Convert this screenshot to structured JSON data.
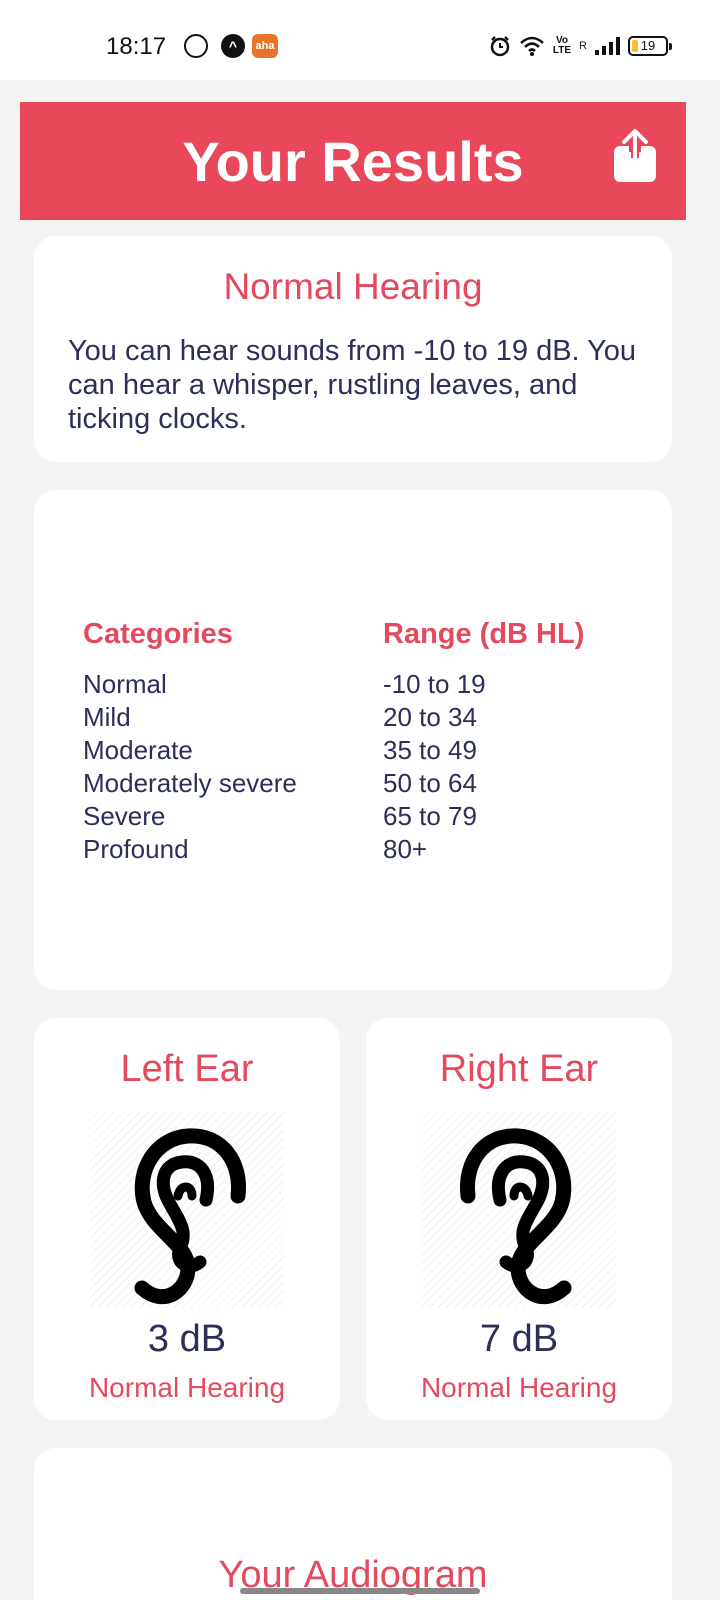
{
  "status_bar": {
    "time": "18:17",
    "battery": "19",
    "network_label": "Vo\nLTE",
    "roaming": "R",
    "apps": [
      "whatsapp-icon",
      "a-icon",
      "aha-icon"
    ],
    "aha_label": "aha"
  },
  "header": {
    "title": "Your Results",
    "background": "#e9475a",
    "share_icon": "share-icon"
  },
  "summary": {
    "title": "Normal Hearing",
    "description": "You can hear sounds from -10 to 19 dB. You can hear a whisper, rustling leaves, and ticking clocks."
  },
  "table": {
    "col1_header": "Categories",
    "col2_header": "Range (dB HL)",
    "categories": [
      "Normal",
      "Mild",
      "Moderate",
      "Moderately severe",
      "Severe",
      "Profound"
    ],
    "ranges": [
      "-10 to 19",
      "20 to 34",
      "35 to 49",
      "50 to 64",
      "65 to 79",
      "80+"
    ]
  },
  "left_ear": {
    "title": "Left Ear",
    "value": "3 dB",
    "status": "Normal Hearing",
    "icon": "ear-icon"
  },
  "right_ear": {
    "title": "Right Ear",
    "value": "7 dB",
    "status": "Normal Hearing",
    "icon": "ear-icon"
  },
  "audiogram": {
    "title": "Your Audiogram"
  },
  "colors": {
    "accent": "#e34a5e",
    "text": "#2c2f5a",
    "background": "#f4f4f4"
  }
}
